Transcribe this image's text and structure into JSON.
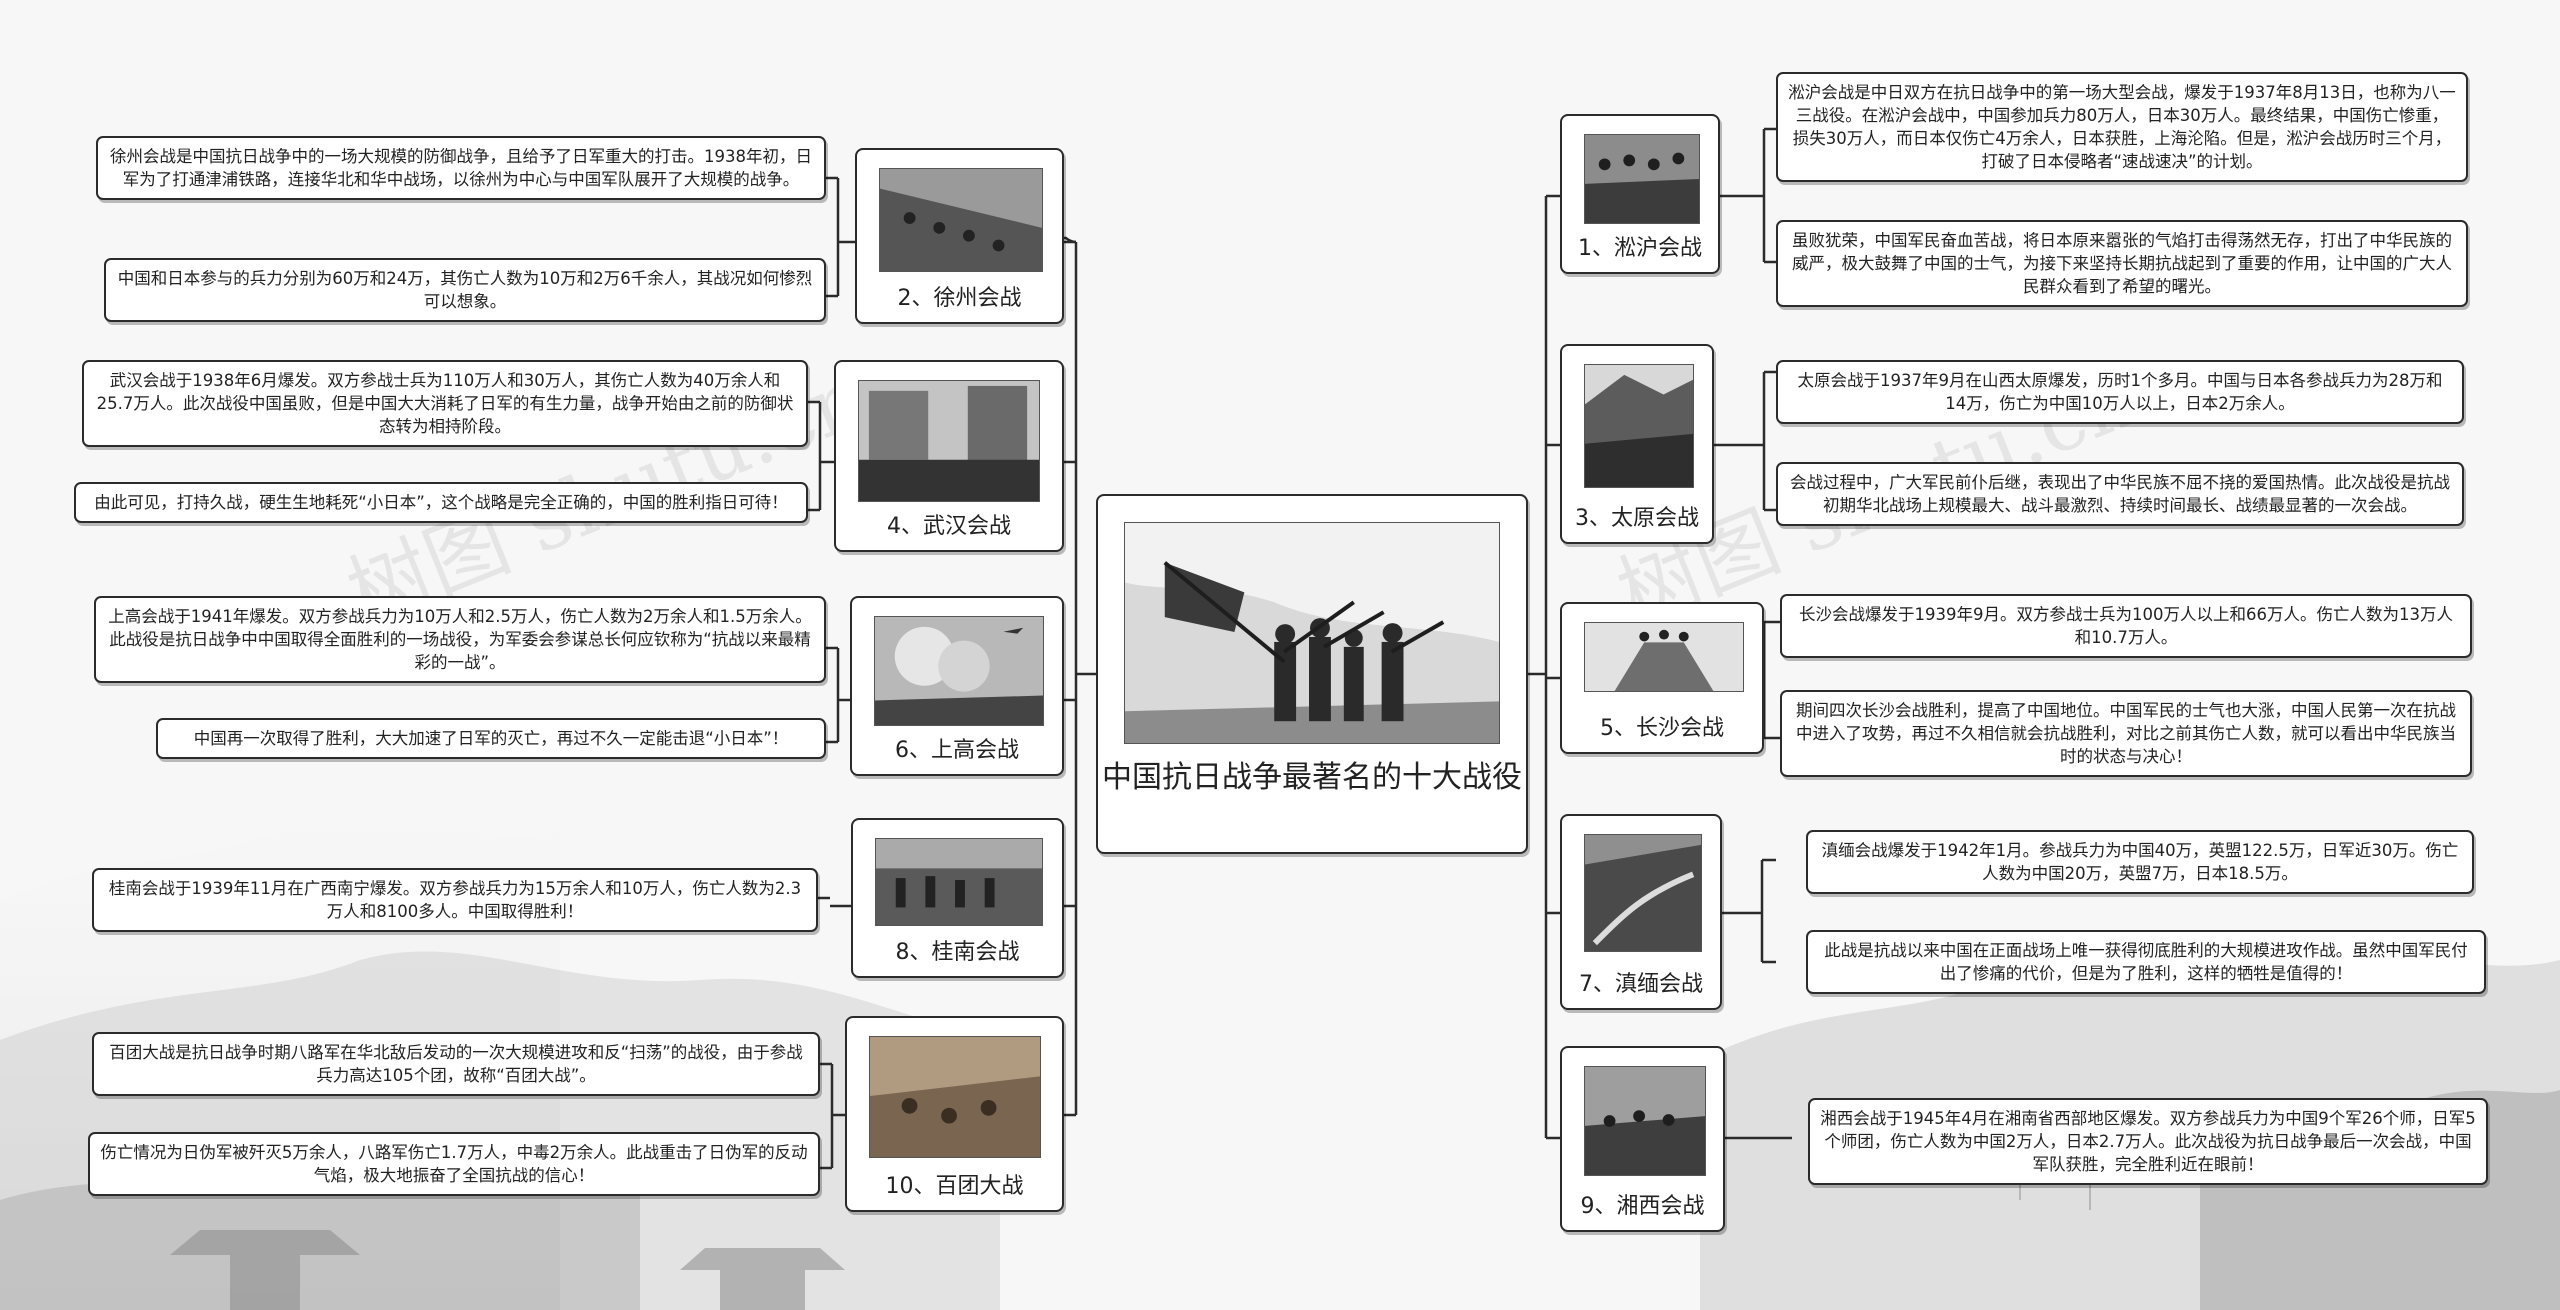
{
  "central_topic": {
    "title": "中国抗日战争最著名的十大战役"
  },
  "watermark": "树图 shutu.cn",
  "battles": [
    {
      "id": "b1",
      "label": "1、淞沪会战",
      "photo": "battle-photo",
      "notes": [
        "淞沪会战是中日双方在抗日战争中的第一场大型会战，爆发于1937年8月13日，也称为八一三战役。在淞沪会战中，中国参加兵力80万人，日本30万人。最终结果，中国伤亡惨重，损失30万人，而日本仅伤亡4万余人，日本获胜，上海沦陷。但是，淞沪会战历时三个月，打破了日本侵略者“速战速决”的计划。",
        "虽败犹荣，中国军民奋血苦战，将日本原来嚣张的气焰打击得荡然无存，打出了中华民族的威严，极大鼓舞了中国的士气，为接下来坚持长期抗战起到了重要的作用，让中国的广大人民群众看到了希望的曙光。"
      ]
    },
    {
      "id": "b2",
      "label": "2、徐州会战",
      "photo": "battle-photo",
      "notes": [
        "徐州会战是中国抗日战争中的一场大规模的防御战争，且给予了日军重大的打击。1938年初，日军为了打通津浦铁路，连接华北和华中战场，以徐州为中心与中国军队展开了大规模的战争。",
        "中国和日本参与的兵力分别为60万和24万，其伤亡人数为10万和2万6千余人，其战况如何惨烈可以想象。"
      ]
    },
    {
      "id": "b3",
      "label": "3、太原会战",
      "photo": "battle-photo",
      "notes": [
        "太原会战于1937年9月在山西太原爆发，历时1个多月。中国与日本各参战兵力为28万和14万，伤亡为中国10万人以上，日本2万余人。",
        "会战过程中，广大军民前仆后继，表现出了中华民族不屈不挠的爱国热情。此次战役是抗战初期华北战场上规模最大、战斗最激烈、持续时间最长、战绩最显著的一次会战。"
      ]
    },
    {
      "id": "b4",
      "label": "4、武汉会战",
      "photo": "battle-photo",
      "notes": [
        "武汉会战于1938年6月爆发。双方参战士兵为110万人和30万人，其伤亡人数为40万余人和25.7万人。此次战役中国虽败，但是中国大大消耗了日军的有生力量，战争开始由之前的防御状态转为相持阶段。",
        "由此可见，打持久战，硬生生地耗死“小日本”，这个战略是完全正确的，中国的胜利指日可待！"
      ]
    },
    {
      "id": "b5",
      "label": "5、长沙会战",
      "photo": "battle-photo",
      "notes": [
        "长沙会战爆发于1939年9月。双方参战士兵为100万人以上和66万人。伤亡人数为13万人和10.7万人。",
        "期间四次长沙会战胜利，提高了中国地位。中国军民的士气也大涨，中国人民第一次在抗战中进入了攻势，再过不久相信就会抗战胜利，对比之前其伤亡人数，就可以看出中华民族当时的状态与决心！"
      ]
    },
    {
      "id": "b6",
      "label": "6、上高会战",
      "photo": "battle-photo",
      "notes": [
        "上高会战于1941年爆发。双方参战兵力为10万人和2.5万人，伤亡人数为2万余人和1.5万余人。此战役是抗日战争中中国取得全面胜利的一场战役，为军委会参谋总长何应钦称为“抗战以来最精彩的一战”。",
        "中国再一次取得了胜利，大大加速了日军的灭亡，再过不久一定能击退“小日本”！"
      ]
    },
    {
      "id": "b7",
      "label": "7、滇缅会战",
      "photo": "battle-photo",
      "notes": [
        "滇缅会战爆发于1942年1月。参战兵力为中国40万，英盟122.5万，日军近30万。伤亡人数为中国20万，英盟7万，日本18.5万。",
        "此战是抗战以来中国在正面战场上唯一获得彻底胜利的大规模进攻作战。虽然中国军民付出了惨痛的代价，但是为了胜利，这样的牺牲是值得的！"
      ]
    },
    {
      "id": "b8",
      "label": "8、桂南会战",
      "photo": "battle-photo",
      "notes": [
        "桂南会战于1939年11月在广西南宁爆发。双方参战兵力为15万余人和10万人，伤亡人数为2.3万人和8100多人。中国取得胜利！"
      ]
    },
    {
      "id": "b9",
      "label": "9、湘西会战",
      "photo": "battle-photo",
      "notes": [
        "湘西会战于1945年4月在湘南省西部地区爆发。双方参战兵力为中国9个军26个师，日军5个师团，伤亡人数为中国2万人，日本2.7万人。此次战役为抗日战争最后一次会战，中国军队获胜，完全胜利近在眼前！"
      ]
    },
    {
      "id": "b10",
      "label": "10、百团大战",
      "photo": "battle-photo",
      "notes": [
        "百团大战是抗日战争时期八路军在华北敌后发动的一次大规模进攻和反“扫荡”的战役，由于参战兵力高达105个团，故称“百团大战”。",
        "伤亡情况为日伪军被歼灭5万余人，八路军伤亡1.7万人，中毒2万余人。此战重击了日伪军的反动气焰，极大地振奋了全国抗战的信心！"
      ]
    }
  ]
}
